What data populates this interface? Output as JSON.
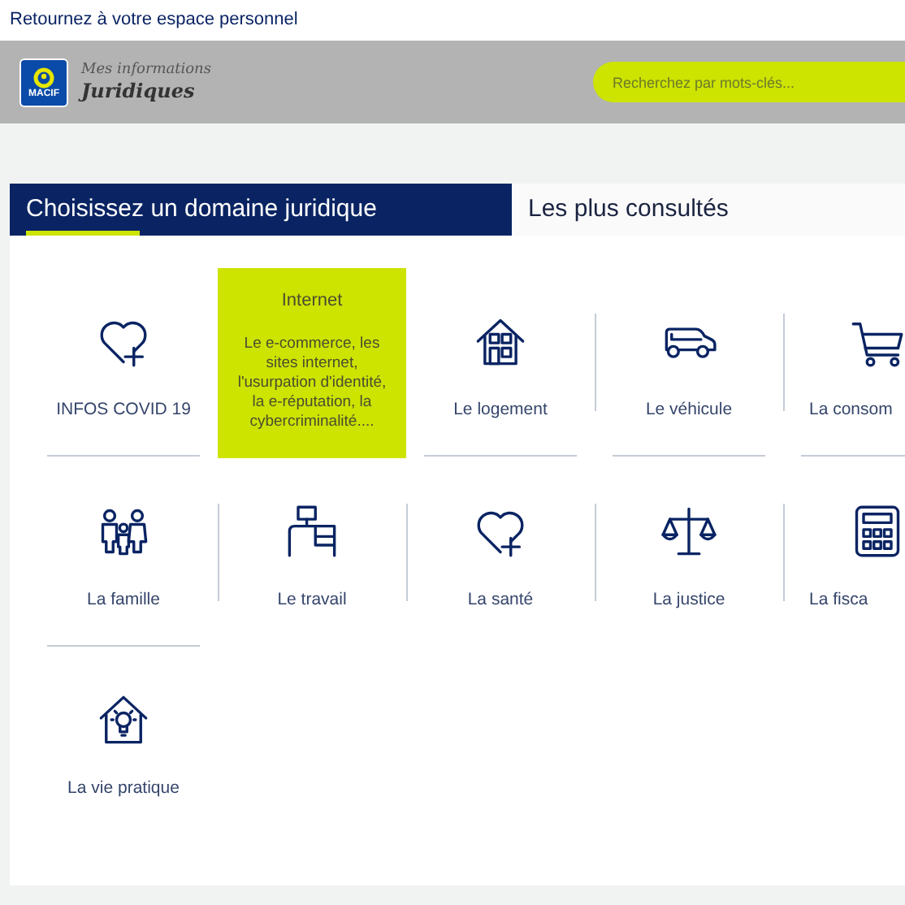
{
  "top_link": "Retournez à votre espace personnel",
  "header": {
    "logo_text": "MACIF",
    "title_line1": "Mes informations",
    "title_line2": "Juridiques",
    "search": {
      "placeholder": "Recherchez par mots-clés..."
    }
  },
  "tabs": [
    {
      "label": "Choisissez un domaine juridique",
      "selected": true
    },
    {
      "label": "Les plus consultés",
      "selected": false
    }
  ],
  "topics": [
    {
      "label": "INFOS COVID 19",
      "highlighted": false
    },
    {
      "label": "Internet",
      "highlighted": true,
      "description": "Le e-commerce, les sites internet, l'usurpation d'identité, la e-réputation, la cybercriminalité...."
    },
    {
      "label": "Le logement",
      "highlighted": false
    },
    {
      "label": "Le véhicule",
      "highlighted": false
    },
    {
      "label": "La consom",
      "highlighted": false
    },
    {
      "label": "La famille",
      "highlighted": false
    },
    {
      "label": "Le travail",
      "highlighted": false
    },
    {
      "label": "La santé",
      "highlighted": false
    },
    {
      "label": "La justice",
      "highlighted": false
    },
    {
      "label": "La fisca",
      "highlighted": false
    },
    {
      "label": "La vie pratique",
      "highlighted": false
    }
  ]
}
